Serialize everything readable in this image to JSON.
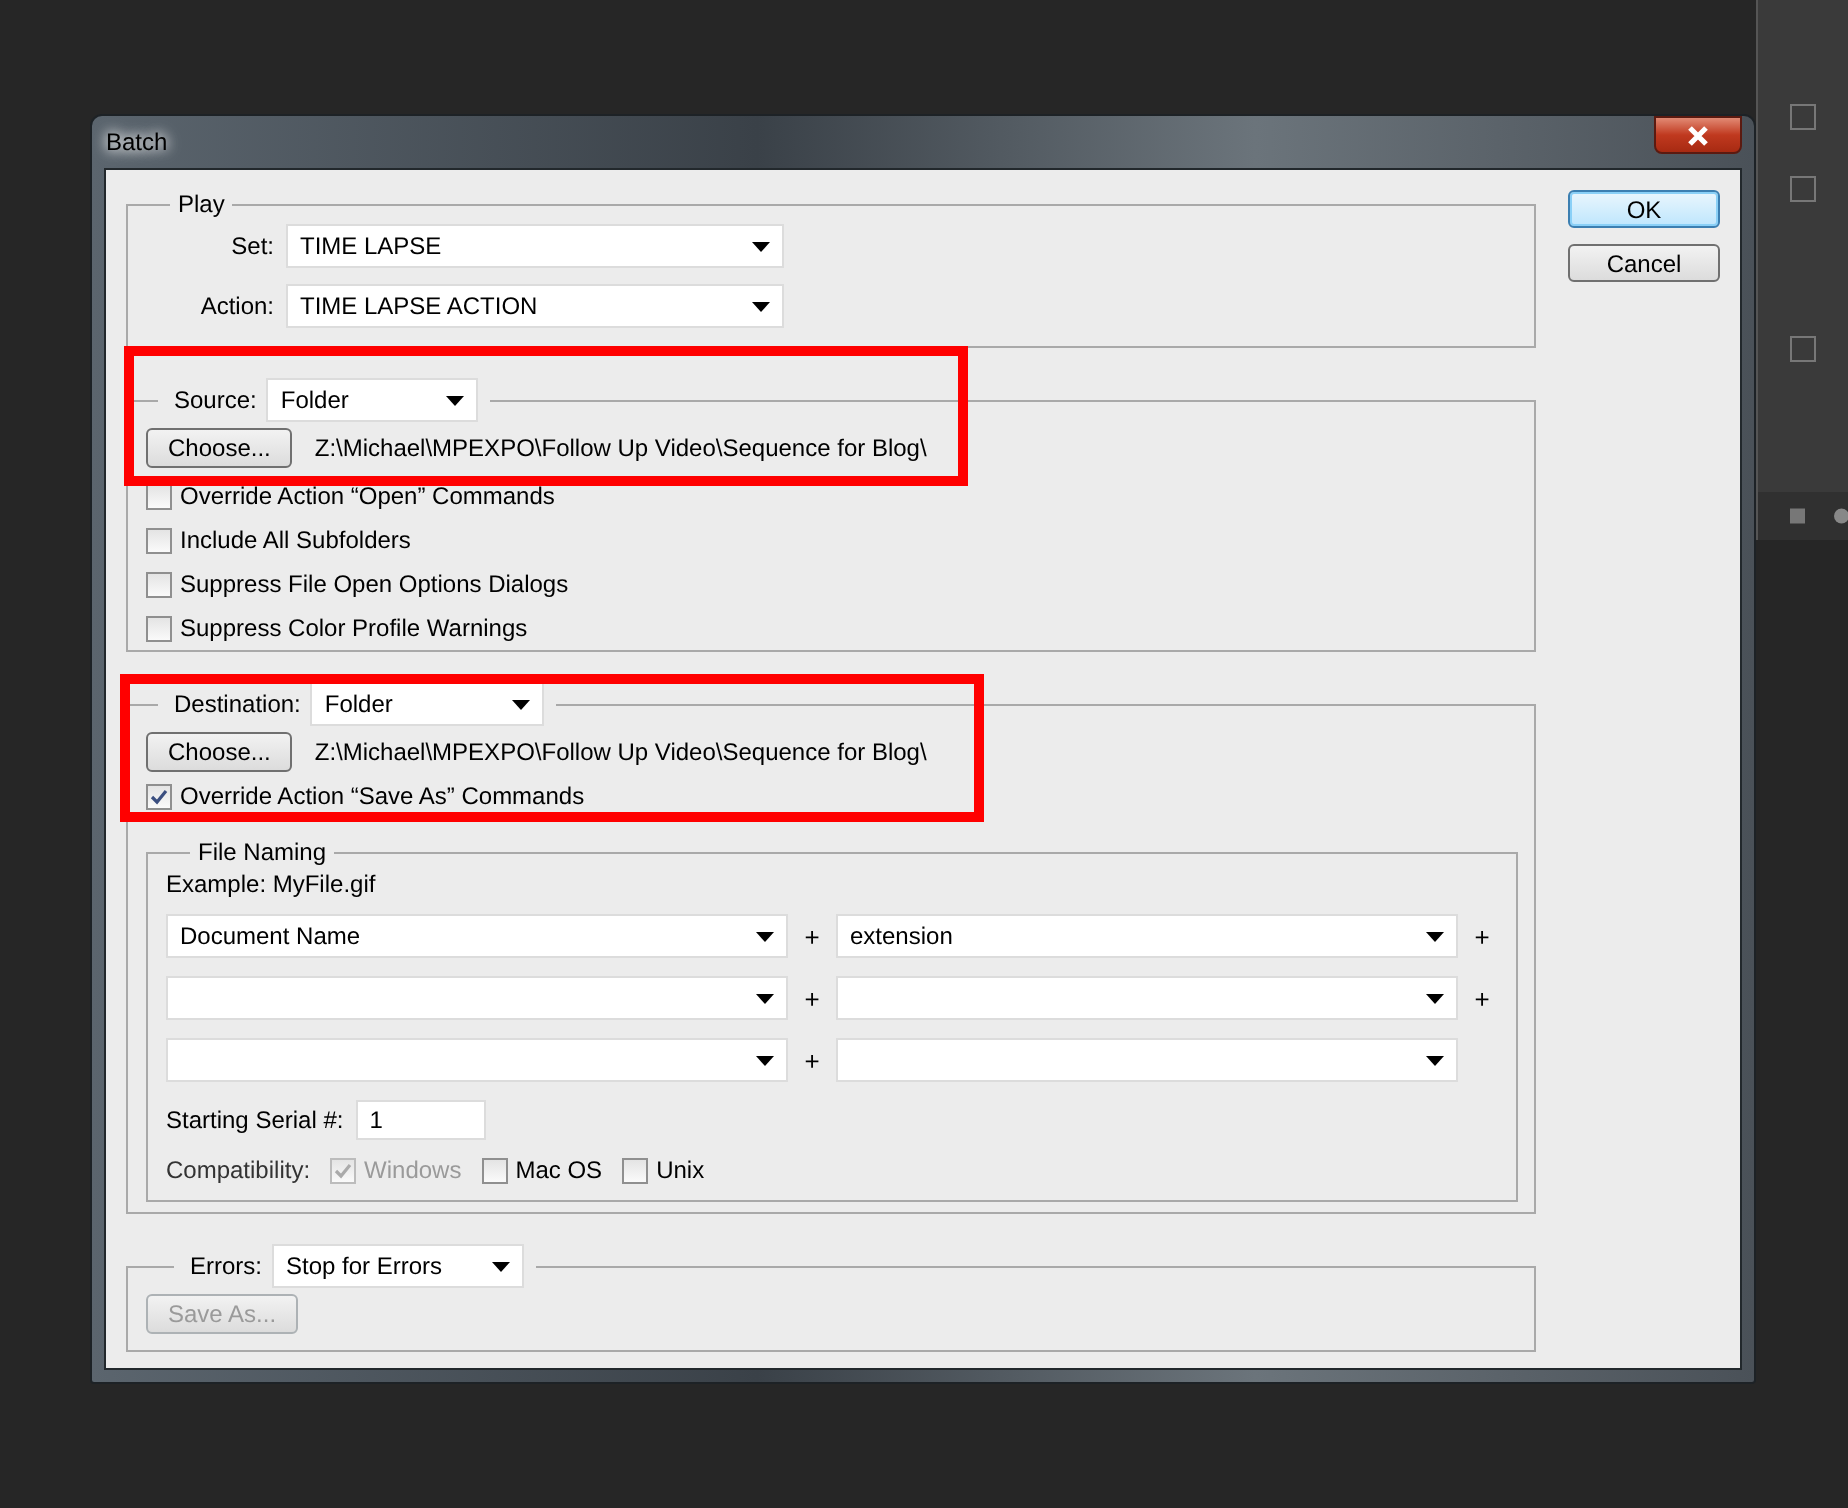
{
  "window": {
    "title": "Batch"
  },
  "play": {
    "legend": "Play",
    "set": {
      "label": "Set:",
      "value": "TIME LAPSE"
    },
    "action": {
      "label": "Action:",
      "value": "TIME LAPSE ACTION"
    }
  },
  "source": {
    "label": "Source:",
    "value": "Folder",
    "highlighted": true,
    "choose_button": "Choose...",
    "path": "Z:\\Michael\\MPEXPO\\Follow Up Video\\Sequence for Blog\\",
    "options": [
      {
        "label": "Override Action “Open” Commands",
        "checked": false
      },
      {
        "label": "Include All Subfolders",
        "checked": false
      },
      {
        "label": "Suppress File Open Options Dialogs",
        "checked": false
      },
      {
        "label": "Suppress Color Profile Warnings",
        "checked": false
      }
    ]
  },
  "destination": {
    "label": "Destination:",
    "value": "Folder",
    "highlighted": true,
    "choose_button": "Choose...",
    "path": "Z:\\Michael\\MPEXPO\\Follow Up Video\\Sequence for Blog\\",
    "options": [
      {
        "label": "Override Action “Save As” Commands",
        "checked": true
      }
    ]
  },
  "file_naming": {
    "legend": "File Naming",
    "example": "Example: MyFile.gif",
    "rows": [
      {
        "first": "Document Name",
        "join": "+",
        "second": "extension",
        "trail": "+"
      },
      {
        "join": "+",
        "trail": "+"
      },
      {
        "join": "+"
      }
    ],
    "serial": {
      "label": "Starting Serial #:",
      "value": "1"
    },
    "compatibility": {
      "label": "Compatibility:",
      "options": [
        {
          "label": "Windows",
          "checked": true,
          "disabled": true
        },
        {
          "label": "Mac OS",
          "checked": false,
          "disabled": false
        },
        {
          "label": "Unix",
          "checked": false,
          "disabled": false
        }
      ]
    }
  },
  "errors": {
    "label": "Errors:",
    "value": "Stop for Errors",
    "save_as_button": {
      "label": "Save As...",
      "disabled": true
    }
  },
  "buttons": [
    {
      "label": "OK",
      "default": true
    },
    {
      "label": "Cancel",
      "default": false
    }
  ]
}
